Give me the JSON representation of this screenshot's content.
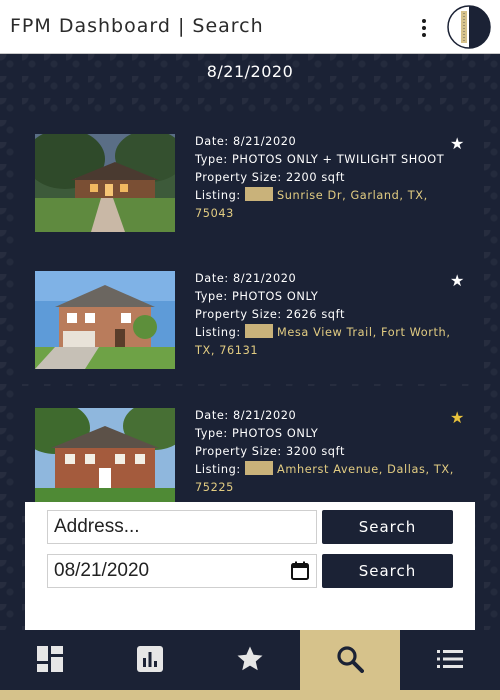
{
  "header": {
    "title": "FPM Dashboard | Search",
    "menu_icon": "kebab-menu-icon",
    "logo_icon": "brand-logo-icon"
  },
  "date_heading": "8/21/2020",
  "listings": [
    {
      "date": "Date: 8/21/2020",
      "type": "Type: PHOTOS ONLY + TWILIGHT SHOOT",
      "size": "Property Size: 2200 sqft",
      "listing_label": "Listing:",
      "address": "Sunrise Dr, Garland, TX, 75043",
      "favorite": false
    },
    {
      "date": "Date: 8/21/2020",
      "type": "Type: PHOTOS ONLY",
      "size": "Property Size: 2626 sqft",
      "listing_label": "Listing:",
      "address": "Mesa View Trail, Fort Worth, TX, 76131",
      "favorite": false
    },
    {
      "date": "Date: 8/21/2020",
      "type": "Type: PHOTOS ONLY",
      "size": "Property Size: 3200 sqft",
      "listing_label": "Listing:",
      "address": "Amherst Avenue, Dallas, TX, 75225",
      "favorite": true
    }
  ],
  "search": {
    "address_placeholder": "Address...",
    "date_value": "08/21/2020",
    "button_label": "Search"
  },
  "nav": {
    "items": [
      {
        "icon": "dashboard-icon",
        "active": false
      },
      {
        "icon": "bar-chart-icon",
        "active": false
      },
      {
        "icon": "star-icon",
        "active": false
      },
      {
        "icon": "search-icon",
        "active": true
      },
      {
        "icon": "list-icon",
        "active": false
      }
    ]
  },
  "colors": {
    "navy": "#1b2235",
    "gold": "#d6c28b",
    "address_gold": "#e2cc82",
    "favorite_star": "#e8c23c"
  }
}
